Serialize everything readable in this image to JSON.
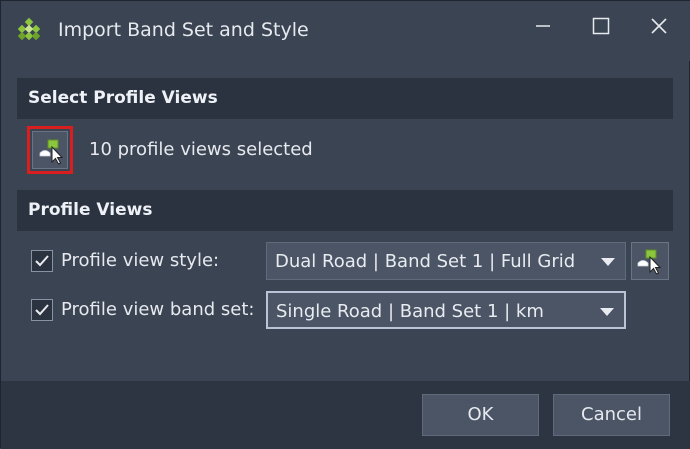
{
  "window": {
    "title": "Import Band Set and Style",
    "controls": [
      "minimize-icon",
      "maximize-icon",
      "close-icon"
    ]
  },
  "select_profile_views": {
    "header": "Select Profile Views",
    "pick_icon": "pick-profile-view-icon",
    "status": "10 profile views selected"
  },
  "profile_views": {
    "header": "Profile Views",
    "style_row": {
      "checked": true,
      "label": "Profile view style:",
      "value": "Dual Road | Band Set 1 | Full Grid",
      "pick_icon": "pick-style-icon"
    },
    "band_set_row": {
      "checked": true,
      "label": "Profile view band set:",
      "value": "Single Road | Band Set 1 | km"
    }
  },
  "footer": {
    "ok_label": "OK",
    "cancel_label": "Cancel"
  },
  "colors": {
    "background": "#3b4453",
    "section_header": "#2b3240",
    "control": "#4b5566",
    "highlight_border": "#d81e1e",
    "accent_green": "#8cc63f"
  }
}
